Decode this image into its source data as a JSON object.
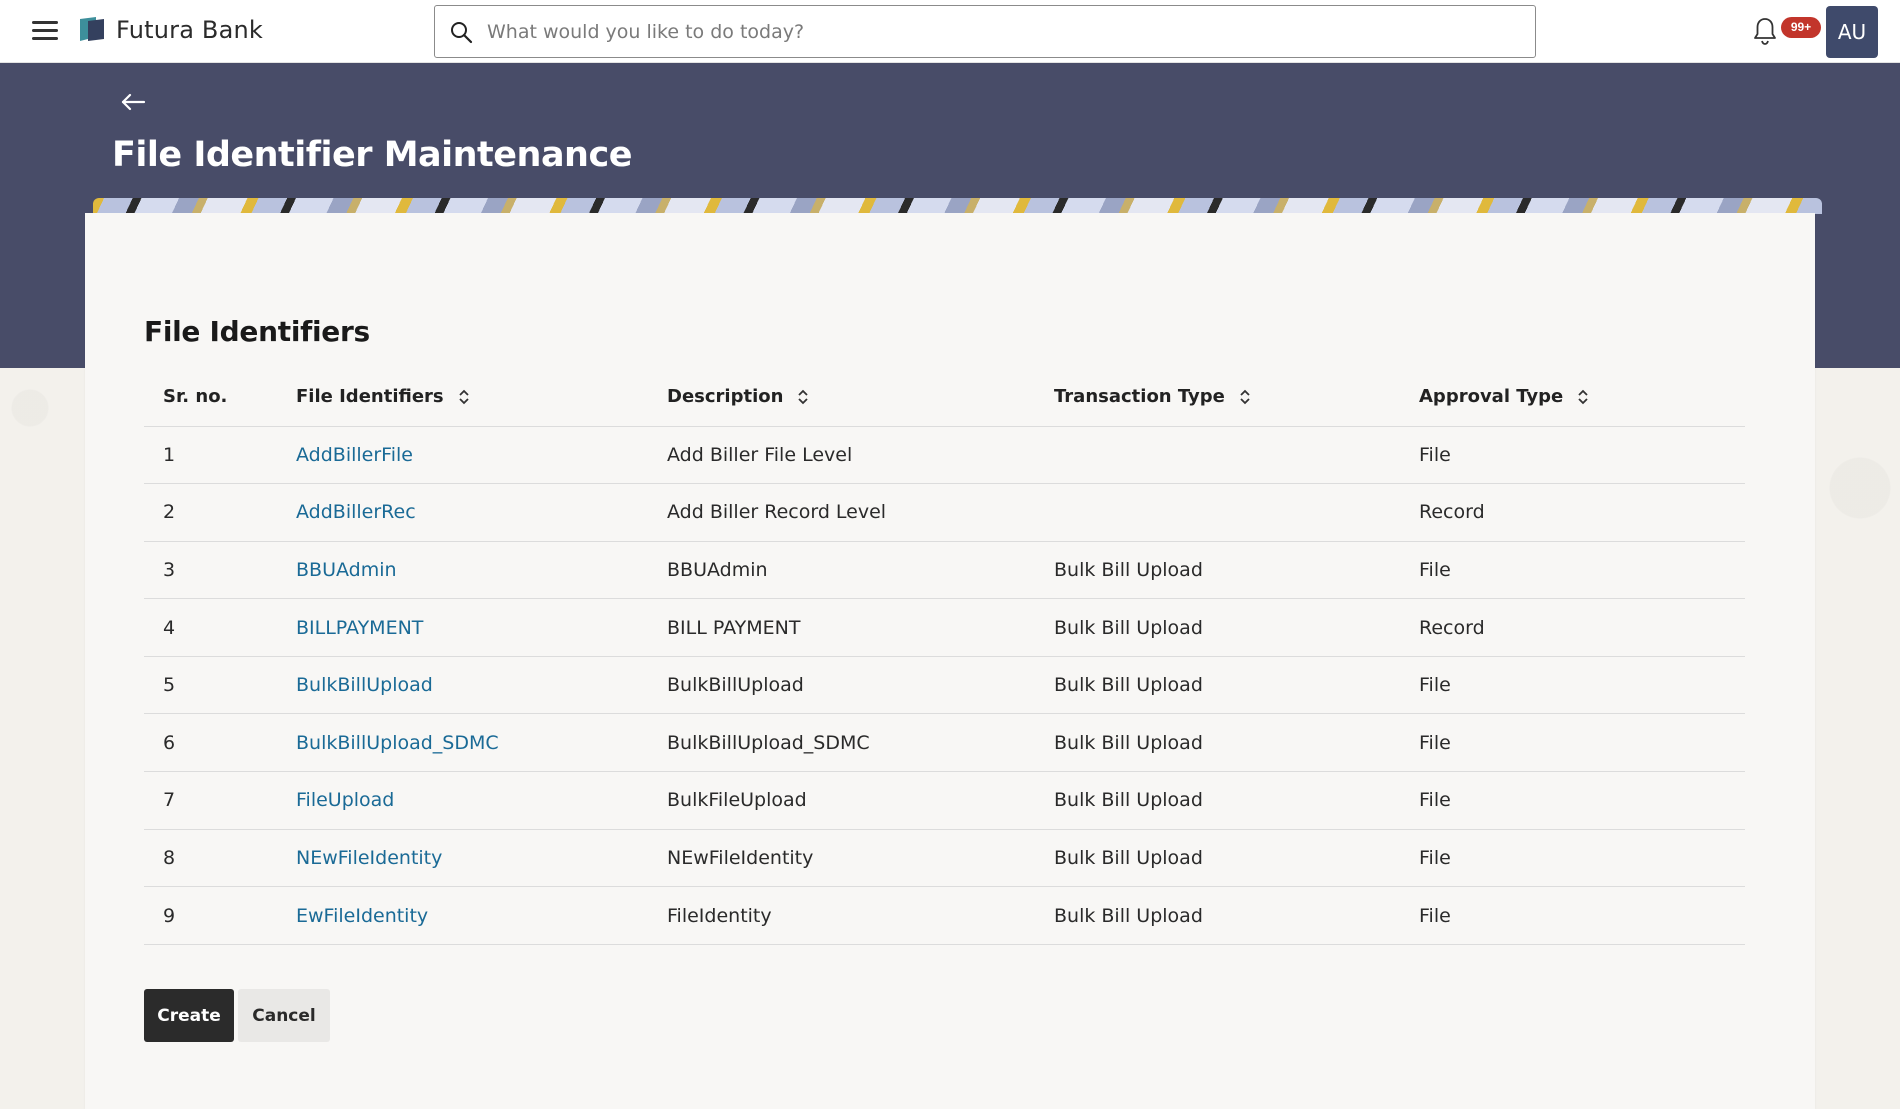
{
  "header": {
    "brand": "Futura Bank",
    "search_placeholder": "What would you like to do today?",
    "notification_badge": "99+",
    "avatar_initials": "AU"
  },
  "page": {
    "title": "File Identifier Maintenance",
    "section_title": "File Identifiers"
  },
  "table": {
    "columns": [
      "Sr. no.",
      "File Identifiers",
      "Description",
      "Transaction Type",
      "Approval Type"
    ],
    "rows": [
      {
        "sr": "1",
        "identifier": "AddBillerFile",
        "description": "Add Biller File Level",
        "transaction_type": "",
        "approval_type": "File"
      },
      {
        "sr": "2",
        "identifier": "AddBillerRec",
        "description": "Add Biller Record Level",
        "transaction_type": "",
        "approval_type": "Record"
      },
      {
        "sr": "3",
        "identifier": "BBUAdmin",
        "description": "BBUAdmin",
        "transaction_type": "Bulk Bill Upload",
        "approval_type": "File"
      },
      {
        "sr": "4",
        "identifier": "BILLPAYMENT",
        "description": "BILL PAYMENT",
        "transaction_type": "Bulk Bill Upload",
        "approval_type": "Record"
      },
      {
        "sr": "5",
        "identifier": "BulkBillUpload",
        "description": "BulkBillUpload",
        "transaction_type": "Bulk Bill Upload",
        "approval_type": "File"
      },
      {
        "sr": "6",
        "identifier": "BulkBillUpload_SDMC",
        "description": "BulkBillUpload_SDMC",
        "transaction_type": "Bulk Bill Upload",
        "approval_type": "File"
      },
      {
        "sr": "7",
        "identifier": "FileUpload",
        "description": "BulkFileUpload",
        "transaction_type": "Bulk Bill Upload",
        "approval_type": "File"
      },
      {
        "sr": "8",
        "identifier": "NEwFileIdentity",
        "description": "NEwFileIdentity",
        "transaction_type": "Bulk Bill Upload",
        "approval_type": "File"
      },
      {
        "sr": "9",
        "identifier": "EwFileIdentity",
        "description": "FileIdentity",
        "transaction_type": "Bulk Bill Upload",
        "approval_type": "File"
      }
    ]
  },
  "buttons": {
    "create": "Create",
    "cancel": "Cancel"
  },
  "colors": {
    "banner": "#484c68",
    "link": "#1a6a96",
    "primary_button": "#2b2b2b",
    "badge": "#c2352b",
    "avatar": "#3f4a6b"
  }
}
